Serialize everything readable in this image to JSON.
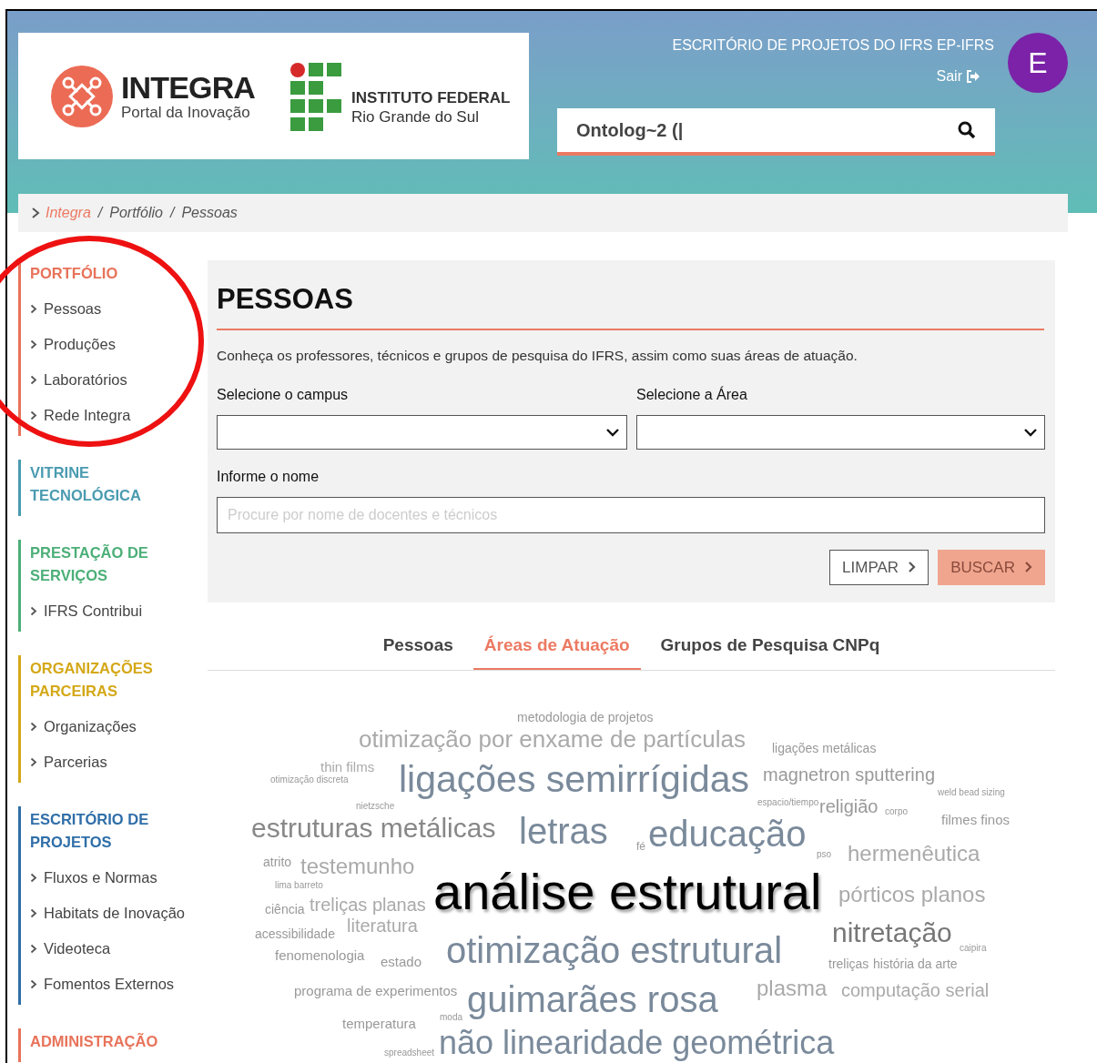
{
  "header": {
    "logo": {
      "name": "INTEGRA",
      "tagline": "Portal da Inovação"
    },
    "institute": {
      "line1": "INSTITUTO FEDERAL",
      "line2": "Rio Grande do Sul"
    },
    "office_title": "ESCRITÓRIO DE PROJETOS DO IFRS EP-IFRS",
    "logout": "Sair",
    "avatar": "E",
    "search": {
      "value": "Ontolog~2 (|"
    }
  },
  "breadcrumb": {
    "separator": "/",
    "items": [
      "Integra",
      "Portfólio",
      "Pessoas"
    ]
  },
  "sidebar": [
    {
      "title": "PORTFÓLIO",
      "color": "#e8735a",
      "items": [
        "Pessoas",
        "Produções",
        "Laboratórios",
        "Rede Integra"
      ]
    },
    {
      "title": "VITRINE TECNOLÓGICA",
      "color": "#4a9bb0"
    },
    {
      "title": "PRESTAÇÃO DE SERVIÇOS",
      "color": "#4caf78",
      "items": [
        "IFRS Contribui"
      ]
    },
    {
      "title": "ORGANIZAÇÕES PARCEIRAS",
      "color": "#d4a817",
      "items": [
        "Organizações",
        "Parcerias"
      ]
    },
    {
      "title": "ESCRITÓRIO DE PROJETOS",
      "color": "#2f6ea8",
      "items": [
        "Fluxos e Normas",
        "Habitats de Inovação",
        "Videoteca",
        "Fomentos Externos"
      ]
    },
    {
      "title": "ADMINISTRAÇÃO",
      "color": "#e8735a"
    }
  ],
  "panel": {
    "title": "PESSOAS",
    "description": "Conheça os professores, técnicos e grupos de pesquisa do IFRS, assim como suas áreas de atuação.",
    "campus_label": "Selecione o campus",
    "area_label": "Selecione a Área",
    "name_label": "Informe o nome",
    "name_placeholder": "Procure por nome de docentes e técnicos",
    "buttons": [
      {
        "label": "LIMPAR",
        "kind": "outline"
      },
      {
        "label": "BUSCAR",
        "kind": "primary"
      }
    ]
  },
  "tabs": [
    {
      "label": "Pessoas",
      "selected": false
    },
    {
      "label": "Áreas de Atuação",
      "selected": true
    },
    {
      "label": "Grupos de Pesquisa CNPq",
      "selected": false
    }
  ],
  "cloud": [
    {
      "text": "metodologia de projetos",
      "color": "#999999"
    },
    {
      "text": "otimização por enxame de partículas",
      "color": "#aaaaaa"
    },
    {
      "text": "ligações metálicas",
      "color": "#999999"
    },
    {
      "text": "thin films",
      "color": "#aaaaaa"
    },
    {
      "text": "otimização discreta",
      "color": "#999999"
    },
    {
      "text": "ligações semirrígidas",
      "color": "#7a8a9b"
    },
    {
      "text": "magnetron sputtering",
      "color": "#999999"
    },
    {
      "text": "weld bead sizing",
      "color": "#999999"
    },
    {
      "text": "nietzsche",
      "color": "#999999"
    },
    {
      "text": "espacio/tiempo",
      "color": "#999999"
    },
    {
      "text": "religião",
      "color": "#999999"
    },
    {
      "text": "corpo",
      "color": "#999999"
    },
    {
      "text": "estruturas metálicas",
      "color": "#888888"
    },
    {
      "text": "letras",
      "color": "#7a8a9b"
    },
    {
      "text": "fé",
      "color": "#999999"
    },
    {
      "text": "educação",
      "color": "#7a8a9b"
    },
    {
      "text": "filmes finos",
      "color": "#999999"
    },
    {
      "text": "pso",
      "color": "#999999"
    },
    {
      "text": "hermenêutica",
      "color": "#aaaaaa"
    },
    {
      "text": "atrito",
      "color": "#999999"
    },
    {
      "text": "testemunho",
      "color": "#aaaaaa"
    },
    {
      "text": "lima barreto",
      "color": "#999999"
    },
    {
      "text": "ciência",
      "color": "#999999"
    },
    {
      "text": "treliças planas",
      "color": "#aaaaaa"
    },
    {
      "text": "análise estrutural",
      "color": "#000000"
    },
    {
      "text": "pórticos planos",
      "color": "#aaaaaa"
    },
    {
      "text": "acessibilidade",
      "color": "#999999"
    },
    {
      "text": "literatura",
      "color": "#aaaaaa"
    },
    {
      "text": "fenomenologia",
      "color": "#999999"
    },
    {
      "text": "estado",
      "color": "#999999"
    },
    {
      "text": "otimização estrutural",
      "color": "#7a8a9b"
    },
    {
      "text": "nitretação",
      "color": "#777777"
    },
    {
      "text": "caipira",
      "color": "#999999"
    },
    {
      "text": "treliças",
      "color": "#999999"
    },
    {
      "text": "história da arte",
      "color": "#999999"
    },
    {
      "text": "programa de experimentos",
      "color": "#999999"
    },
    {
      "text": "guimarães rosa",
      "color": "#7a8a9b"
    },
    {
      "text": "plasma",
      "color": "#aaaaaa"
    },
    {
      "text": "computação serial",
      "color": "#aaaaaa"
    },
    {
      "text": "temperatura",
      "color": "#999999"
    },
    {
      "text": "moda",
      "color": "#999999"
    },
    {
      "text": "spreadsheet",
      "color": "#999999"
    },
    {
      "text": "não linearidade geométrica",
      "color": "#7a8a9b"
    }
  ]
}
